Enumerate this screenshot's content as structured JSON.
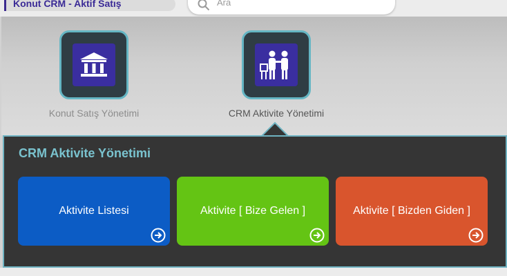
{
  "app": {
    "title": "Konut CRM - Aktif Satış"
  },
  "search": {
    "placeholder": "Ara"
  },
  "modules": [
    {
      "label": "Konut Satış Yönetimi",
      "icon": "bank-icon",
      "active": false
    },
    {
      "label": "CRM Aktivite Yönetimi",
      "icon": "people-icon",
      "active": true
    }
  ],
  "panel": {
    "title": "CRM Aktivite Yönetimi",
    "cards": [
      {
        "label": "Aktivite Listesi",
        "color": "#0c5cc5"
      },
      {
        "label": "Aktivite [ Bize Gelen ]",
        "color": "#64c414"
      },
      {
        "label": "Aktivite [ Bizden Giden ]",
        "color": "#d9552d"
      }
    ]
  },
  "colors": {
    "accent": "#6fb3c2",
    "tile_inner": "#3a2ea0",
    "title": "#3a2a96"
  }
}
